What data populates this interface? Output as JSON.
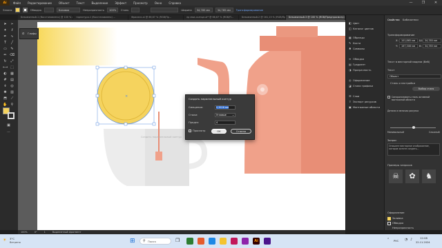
{
  "menubar": {
    "items": [
      "Файл",
      "Редактирование",
      "Объект",
      "Текст",
      "Выделение",
      "Эффект",
      "Просмотр",
      "Окно",
      "Справка"
    ],
    "window_controls": [
      "—",
      "❐",
      "✕"
    ]
  },
  "control_bar": {
    "object_kind": "Эллипс",
    "stroke_label": "Обводка",
    "profile": "Базовая",
    "opacity_label": "Непрозрачность",
    "opacity_value": "100%",
    "style_label": "Стиль",
    "width_label": "Ширина",
    "width_value": "34,785 мм",
    "height_value": "34,785 мм",
    "transform_label": "Трансформирование"
  },
  "tabs": [
    {
      "label": "Безымянный-1 (Восстановлено) @ 100 % (RGB/П",
      "active": false
    },
    {
      "label": "гарнитура-1 (Восстановлено) ...",
      "active": false
    },
    {
      "label": "Фриланс.ai @ 66,67 % (RGB/Пр...",
      "active": false
    },
    {
      "label": "лр мои-солнце.ai* @ 66,67 % (RGB/П...",
      "active": false
    },
    {
      "label": "Безымянный-2 @ 161,15 % (RGB/Про...",
      "active": false
    },
    {
      "label": "Безымянный-3 @ 100 % (RGB/Предпросмотр)",
      "active": true
    }
  ],
  "floating_panel": {
    "label": "Глифы"
  },
  "dock": {
    "items": [
      {
        "icon": "swatch-icon",
        "label": "Цвет"
      },
      {
        "icon": "guide-icon",
        "label": "Каталог цветов"
      },
      {
        "icon": "pattern-icon",
        "label": "Образцы"
      },
      {
        "icon": "brush-icon",
        "label": "Кисти"
      },
      {
        "icon": "symbol-icon",
        "label": "Символы"
      },
      {
        "icon": "stroke-icon",
        "label": "Обводка"
      },
      {
        "icon": "gradient-icon",
        "label": "Градиент"
      },
      {
        "icon": "transparency-icon",
        "label": "Прозрачность"
      },
      {
        "icon": "appearance-icon",
        "label": "Оформление"
      },
      {
        "icon": "graphic-styles-icon",
        "label": "Стили графики"
      },
      {
        "icon": "layers-icon",
        "label": "Слои"
      },
      {
        "icon": "asset-export-icon",
        "label": "Экспорт ресурсов"
      },
      {
        "icon": "artboards-icon",
        "label": "Монтажные области"
      }
    ]
  },
  "properties": {
    "tabs": [
      "Свойства",
      "Библиотеки"
    ],
    "section_transform": "Трансформирование",
    "x_label": "X:",
    "x_value": "101,865 мм",
    "y_label": "Y:",
    "y_value": "167,308 мм",
    "w_label": "Ш:",
    "w_value": "34,785 мм",
    "h_label": "В:",
    "h_value": "34,785 мм",
    "section_text": "Текст в векторной модели (Веб)",
    "section_type": "Текст",
    "subject_label": "Объект",
    "subject_hint": "Стиль и настройки",
    "choose_style": "Выбор стиля",
    "check_1": "Синхронизовать стиль активной монтажной области",
    "detail_label": "Детали в мелочах рисунка",
    "slider_min": "Минимальный",
    "slider_max": "Сложный",
    "prompt_label": "Запрос",
    "prompt_text": "Опишите векторное изображение, которое хотите создать...",
    "examples_label": "Примеры запросов",
    "appearance_label": "Оформление",
    "fill_label": "Заливка",
    "stroke_label": "Обводка",
    "opacity_label": "Непрозрачность"
  },
  "dialog": {
    "title": "Создать параллельный контур",
    "offset_label": "Смещение:",
    "offset_value": "0,3528 мм",
    "joins_label": "Стыки:",
    "joins_value": "Угловые",
    "miter_label": "Предел:",
    "miter_value": "4",
    "preview_label": "Просмотр",
    "ok_label": "ОК",
    "cancel_label": "Отмена"
  },
  "canvas_text": "Создать параллельный контур",
  "status": {
    "zoom": "100%",
    "angle": "0°",
    "artboard": "1",
    "tool": "Выделенный фрагмент"
  },
  "taskbar": {
    "weather_temp": "3°C",
    "weather_text": "Ветрено",
    "search_placeholder": "Поиск",
    "time": "12:08",
    "date": "22.11.2024",
    "lang": "РУС"
  },
  "colors": {
    "accent": "#ff9a00",
    "sun_fill": "#f5d35e",
    "teapot": "#f0a18a",
    "teapot_dark": "#e88e76",
    "cup": "#ececec"
  }
}
